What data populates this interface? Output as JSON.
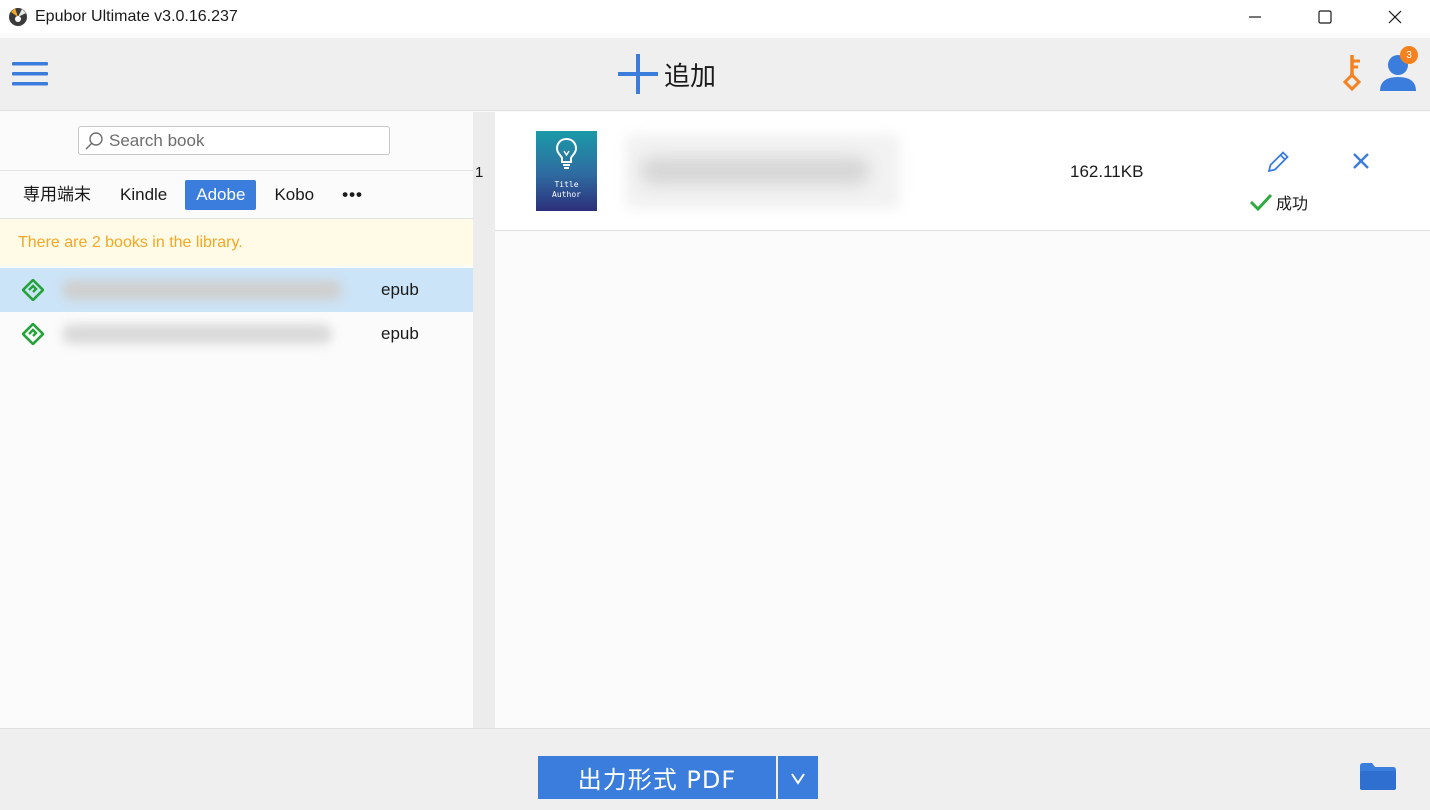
{
  "window": {
    "title": "Epubor Ultimate v3.0.16.237",
    "controls": [
      "minimize-icon",
      "maximize-icon",
      "close-icon"
    ]
  },
  "toolbar": {
    "add_label": "追加",
    "notification_count": "3"
  },
  "search": {
    "placeholder": "Search book"
  },
  "tabs": [
    {
      "label": "専用端末",
      "active": false
    },
    {
      "label": "Kindle",
      "active": false
    },
    {
      "label": "Adobe",
      "active": true
    },
    {
      "label": "Kobo",
      "active": false
    },
    {
      "label": "•••",
      "active": false
    }
  ],
  "library": {
    "notice": "There are 2 books in the library.",
    "books": [
      {
        "format": "epub",
        "selected": true
      },
      {
        "format": "epub",
        "selected": false
      }
    ]
  },
  "conversion_list": {
    "items": [
      {
        "index": "1",
        "cover_title": "Title",
        "cover_author": "Author",
        "size": "162.11KB",
        "status": "成功"
      }
    ]
  },
  "bottom": {
    "convert_label": "出力形式 PDF"
  },
  "colors": {
    "accent": "#3b7ddd",
    "notice_text": "#f5a623",
    "success": "#2eaa3f",
    "key_orange": "#f5821f",
    "book_icon_green": "#22a33a"
  }
}
